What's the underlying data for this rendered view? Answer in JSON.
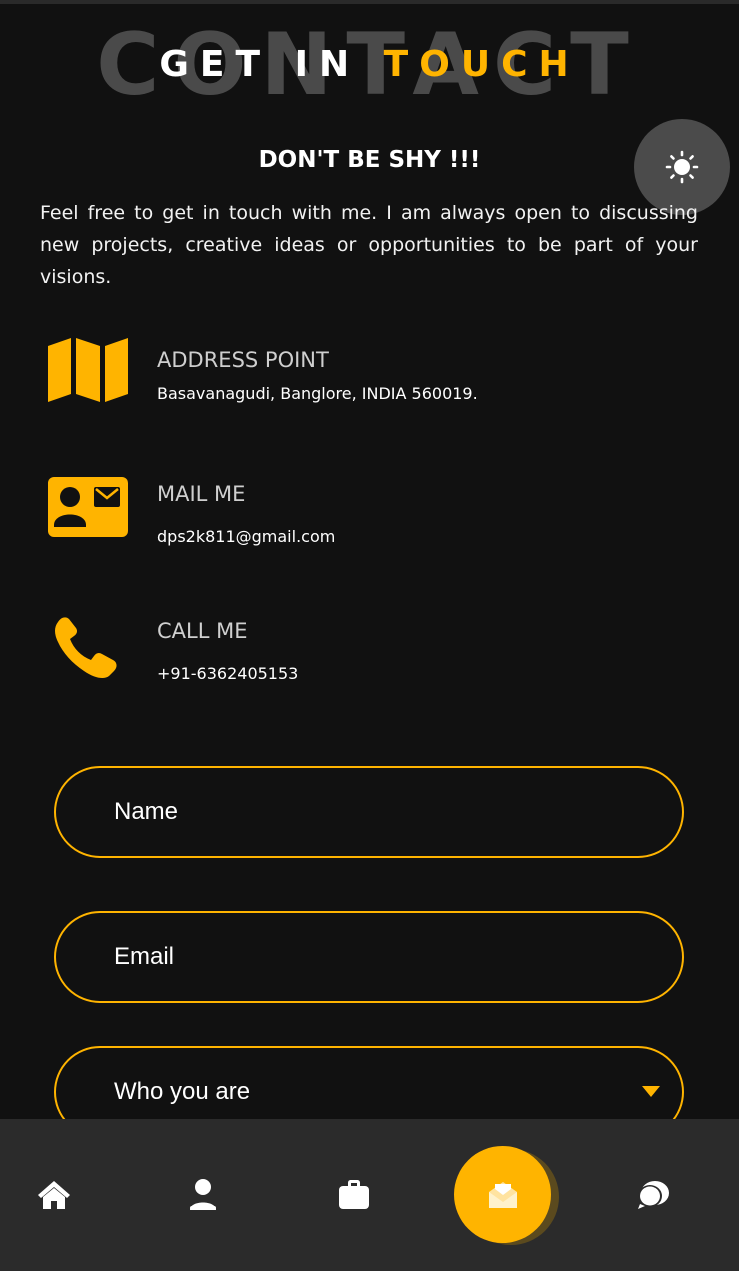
{
  "heading": {
    "background_word": "CONTACT",
    "word1": "GET IN",
    "word2": "TOUCH"
  },
  "subheading": "DON'T BE SHY !!!",
  "intro": "Feel free to get in touch with me. I am always open to discussing new projects, creative ideas or opportunities to be part of your visions.",
  "contacts": [
    {
      "icon": "map-icon",
      "label": "ADDRESS POINT",
      "value": "Basavanagudi, Banglore, INDIA 560019."
    },
    {
      "icon": "contact-card-icon",
      "label": "MAIL ME",
      "value": "dps2k811@gmail.com"
    },
    {
      "icon": "phone-icon",
      "label": "CALL ME",
      "value": "+91-6362405153"
    }
  ],
  "form": {
    "name_placeholder": "Name",
    "email_placeholder": "Email",
    "who_selected": "Who you are"
  },
  "nav": {
    "items": [
      {
        "icon": "home-icon",
        "active": false
      },
      {
        "icon": "user-icon",
        "active": false
      },
      {
        "icon": "briefcase-icon",
        "active": false
      },
      {
        "icon": "envelope-open-icon",
        "active": true
      },
      {
        "icon": "chat-icon",
        "active": false
      }
    ]
  },
  "colors": {
    "accent": "#ffb400",
    "background": "#111111",
    "nav_background": "#2b2b2b",
    "toggle_background": "#4b4b4b"
  }
}
